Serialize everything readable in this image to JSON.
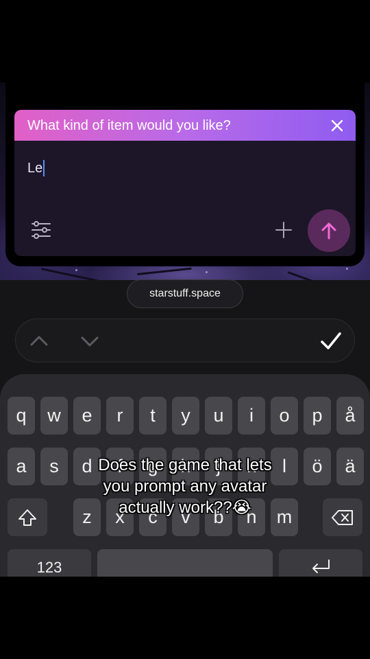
{
  "dialog": {
    "title": "What kind of item would you like?",
    "input_value": "Le"
  },
  "icons": {
    "close": "close-icon",
    "settings": "sliders-icon",
    "add": "plus-icon",
    "send": "arrow-up-icon",
    "prev": "chevron-up-icon",
    "next": "chevron-down-icon",
    "done": "checkmark-icon",
    "shift": "shift-icon",
    "backspace": "backspace-icon",
    "return": "return-icon"
  },
  "browser": {
    "url": "starstuff.space"
  },
  "keyboard": {
    "row1": [
      "q",
      "w",
      "e",
      "r",
      "t",
      "y",
      "u",
      "i",
      "o",
      "p",
      "å"
    ],
    "row2": [
      "a",
      "s",
      "d",
      "f",
      "g",
      "h",
      "j",
      "k",
      "l",
      "ö",
      "ä"
    ],
    "row3": [
      "z",
      "x",
      "c",
      "v",
      "b",
      "n",
      "m"
    ],
    "numbers_label": "123"
  },
  "caption": {
    "line1": "Does the game that lets",
    "line2": "you prompt any avatar",
    "line3": "actually work??😭"
  },
  "colors": {
    "header_gradient_start": "#e160c6",
    "header_gradient_end": "#8f5cf0",
    "send_button": "#5b2a5c",
    "send_arrow": "#f06bd6",
    "caret": "#5a8cff"
  }
}
